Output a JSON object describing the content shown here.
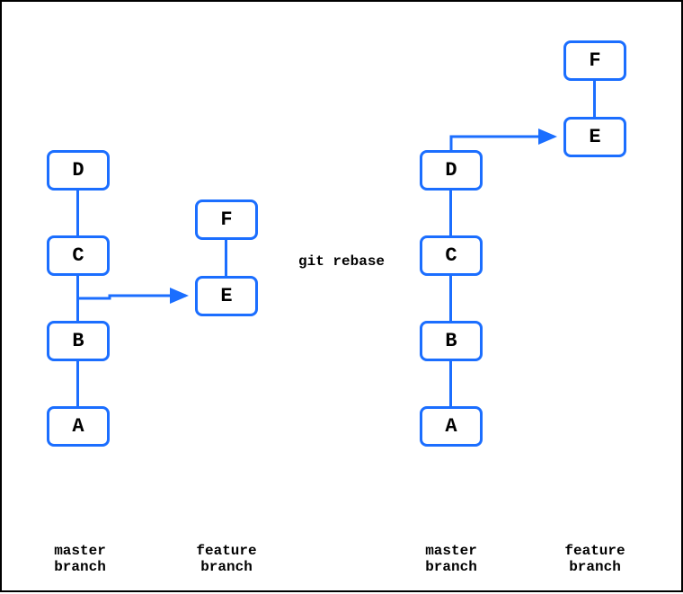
{
  "command": "git rebase",
  "before": {
    "master": {
      "label": "master\nbranch",
      "commits": [
        "A",
        "B",
        "C",
        "D"
      ]
    },
    "feature": {
      "label": "feature\nbranch",
      "commits": [
        "E",
        "F"
      ],
      "branches_from": "B"
    }
  },
  "after": {
    "master": {
      "label": "master\nbranch",
      "commits": [
        "A",
        "B",
        "C",
        "D"
      ]
    },
    "feature": {
      "label": "feature\nbranch",
      "commits": [
        "E",
        "F"
      ],
      "branches_from": "D"
    }
  }
}
